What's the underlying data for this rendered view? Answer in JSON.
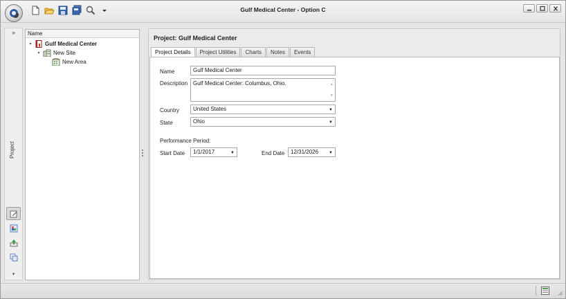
{
  "window": {
    "title": "Gulf Medical Center - Option C"
  },
  "quick_access": [
    {
      "name": "new-document-icon"
    },
    {
      "name": "open-folder-icon"
    },
    {
      "name": "save-icon"
    },
    {
      "name": "save-all-icon"
    },
    {
      "name": "search-icon"
    },
    {
      "name": "customize-dropdown-icon"
    }
  ],
  "rail": {
    "expand_label": "»",
    "vertical_label": "Project",
    "more_label": "▾",
    "icons": [
      "edit-project-icon",
      "reports-icon",
      "export-icon",
      "copy-icon"
    ]
  },
  "tree": {
    "header": "Name",
    "items": [
      {
        "label": "Gulf Medical Center",
        "level": 0,
        "bold": true,
        "icon": "project-book-icon",
        "expanded": true
      },
      {
        "label": "New Site",
        "level": 1,
        "bold": false,
        "icon": "building-icon",
        "expanded": true
      },
      {
        "label": "New Area",
        "level": 2,
        "bold": false,
        "icon": "area-icon",
        "expanded": false
      }
    ]
  },
  "main": {
    "title": "Project: Gulf Medical Center",
    "tabs": [
      "Project Details",
      "Project Utilities",
      "Charts",
      "Notes",
      "Events"
    ],
    "active_tab": "Project Details",
    "form": {
      "name_label": "Name",
      "name_value": "Gulf Medical Center",
      "description_label": "Description",
      "description_value": "Gulf Medical Center: Columbus, Ohio.",
      "country_label": "Country",
      "country_value": "United States",
      "state_label": "State",
      "state_value": "Ohio",
      "performance_label": "Performance Period:",
      "start_label": "Start Date",
      "start_value": "1/1/2017",
      "end_label": "End Date",
      "end_value": "12/31/2026"
    }
  },
  "colors": {
    "accent_blue": "#2b5aa8",
    "panel_bg": "#ebebeb",
    "border": "#b9b9b9"
  }
}
